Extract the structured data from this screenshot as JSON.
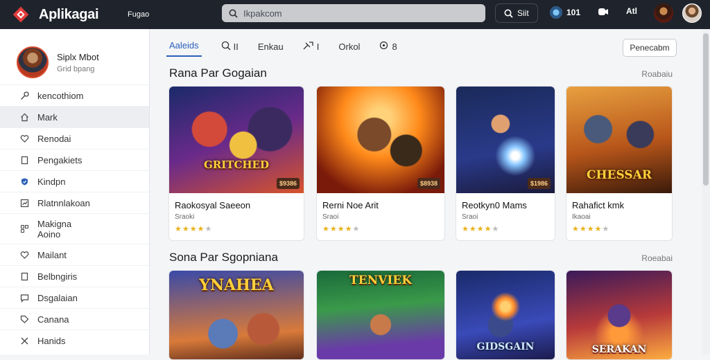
{
  "topbar": {
    "app_title": "Aplikagai",
    "nav_link": "Fugao",
    "search_placeholder": "Ikpakcom",
    "search_button": "Siit",
    "counter": "101",
    "extra_label": "Atl"
  },
  "profile": {
    "name": "Siplx Mbot",
    "subtitle": "Grid bpang"
  },
  "sidebar": {
    "items": [
      {
        "label": "kencothiom",
        "icon": "key-icon"
      },
      {
        "label": "Mark",
        "icon": "home-icon"
      },
      {
        "label": "Renodai",
        "icon": "heart-icon"
      },
      {
        "label": "Pengakiets",
        "icon": "document-icon"
      },
      {
        "label": "Kindpn",
        "icon": "shield-icon"
      },
      {
        "label": "Rlatnnlakoan",
        "icon": "chart-icon"
      },
      {
        "label": "Makigna Aoino",
        "icon": "grid-icon"
      },
      {
        "label": "Mailant",
        "icon": "heart-icon"
      },
      {
        "label": "Belbngiris",
        "icon": "document-icon"
      },
      {
        "label": "Dsgalaian",
        "icon": "chat-icon"
      },
      {
        "label": "Canana",
        "icon": "tag-icon"
      },
      {
        "label": "Hanids",
        "icon": "cross-icon"
      }
    ]
  },
  "tabs": [
    {
      "label": "Aaleids",
      "icon": ""
    },
    {
      "label": "II",
      "icon": "search-icon"
    },
    {
      "label": "Enkau",
      "icon": ""
    },
    {
      "label": "I",
      "icon": "tool-icon"
    },
    {
      "label": "Orkol",
      "icon": ""
    },
    {
      "label": "8",
      "icon": "search-icon"
    }
  ],
  "filter_button": "Penecabm",
  "sections": [
    {
      "title": "Rana Par Gogaian",
      "more": "Roabaiu",
      "cards": [
        {
          "title": "Raokosyal Saeeon",
          "sub": "Sraoki",
          "rating": 4.5,
          "price": "$9386",
          "banner": "GRITCHED"
        },
        {
          "title": "Rerni Noe Arit",
          "sub": "Sraoi",
          "rating": 4.5,
          "price": "$8938",
          "banner": ""
        },
        {
          "title": "Reotkyn0 Mams",
          "sub": "Sraoi",
          "rating": 4.5,
          "price": "$1986",
          "banner": ""
        },
        {
          "title": "Rahafict kmk",
          "sub": "Ikaoai",
          "rating": 4.5,
          "price": "",
          "banner": "CHESSAR"
        }
      ]
    },
    {
      "title": "Sona Par Sgopniana",
      "more": "Roeabai",
      "cards": [
        {
          "title": "",
          "sub": "",
          "rating": 0,
          "price": "",
          "banner": "YNAHEA"
        },
        {
          "title": "",
          "sub": "",
          "rating": 0,
          "price": "",
          "banner": "TENVIEK"
        },
        {
          "title": "",
          "sub": "",
          "rating": 0,
          "price": "",
          "banner": "GIDSGAIN"
        },
        {
          "title": "",
          "sub": "",
          "rating": 0,
          "price": "",
          "banner": "SERAKAN"
        }
      ]
    }
  ],
  "colors": {
    "topbar": "#1f242c",
    "accent": "#2b5fb8",
    "logo": "#e23b3b",
    "star": "#e8b21c"
  }
}
